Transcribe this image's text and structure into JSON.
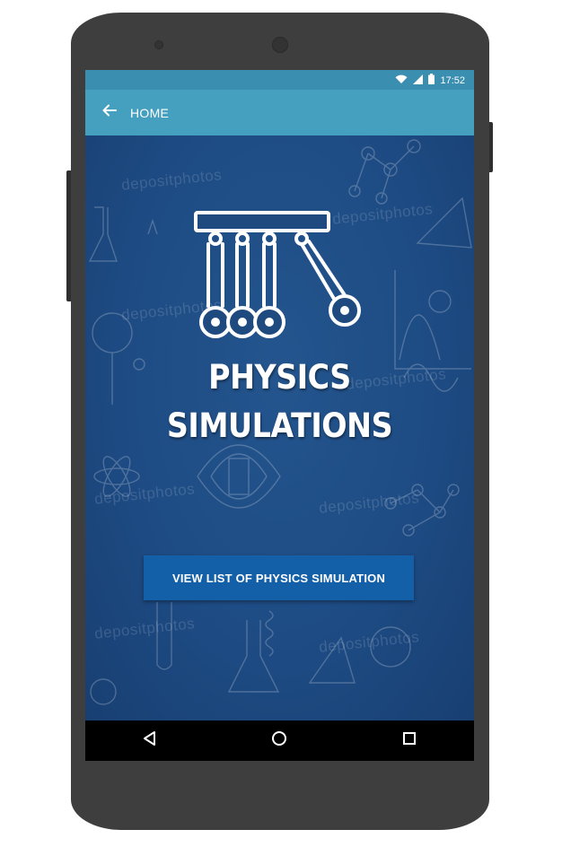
{
  "status_bar": {
    "time": "17:52",
    "icons": [
      "wifi-icon",
      "signal-icon",
      "battery-icon"
    ]
  },
  "app_bar": {
    "title": "HOME",
    "back_icon": "arrow-left-icon"
  },
  "hero": {
    "icon": "newtons-cradle-icon",
    "title_line1": "PHYSICS",
    "title_line2": "SIMULATIONS",
    "watermark": "depositphotos"
  },
  "cta": {
    "label": "VIEW LIST OF PHYSICS SIMULATION"
  },
  "nav_bar": {
    "icons": [
      "back-triangle-icon",
      "home-circle-icon",
      "recents-square-icon"
    ]
  },
  "colors": {
    "status_bar": "#3a8eb0",
    "app_bar": "#45a0c0",
    "hero_bg": "#1f4a80",
    "button": "#1360a8",
    "phone_frame": "#3e3e3e"
  }
}
